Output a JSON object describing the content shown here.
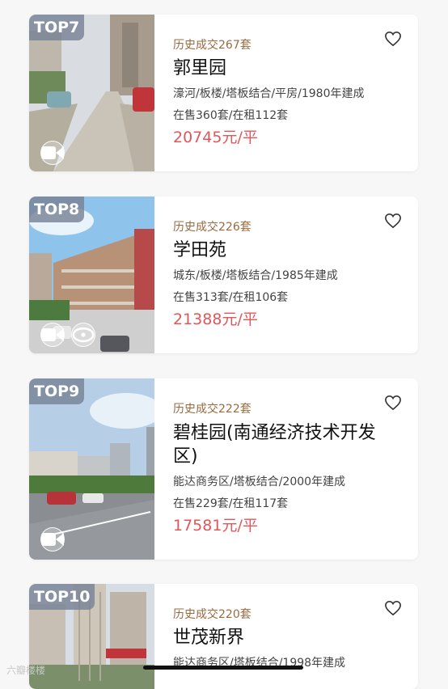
{
  "listings": [
    {
      "rank": "TOP7",
      "deals": "历史成交267套",
      "name": "郭里园",
      "meta": "濠河/板楼/塔板结合/平房/1980年建成",
      "stock": "在售360套/在租112套",
      "price": "20745元/平",
      "colors": {
        "sky": "#d9dde2",
        "ground": "#c9c3b8"
      }
    },
    {
      "rank": "TOP8",
      "deals": "历史成交226套",
      "name": "学田苑",
      "meta": "城东/板楼/塔板结合/1985年建成",
      "stock": "在售313套/在租106套",
      "price": "21388元/平",
      "colors": {
        "sky": "#8ec3ec",
        "ground": "#cfcfcf"
      }
    },
    {
      "rank": "TOP9",
      "deals": "历史成交222套",
      "name": "碧桂园(南通经济技术开发区)",
      "meta": "能达商务区/塔板结合/2000年建成",
      "stock": "在售229套/在租117套",
      "price": "17581元/平",
      "colors": {
        "sky": "#b6cfe6",
        "ground": "#8a8d92"
      }
    },
    {
      "rank": "TOP10",
      "deals": "历史成交220套",
      "name": "世茂新界",
      "meta": "能达商务区/塔板结合/1998年建成",
      "stock": "",
      "price": "",
      "colors": {
        "sky": "#d6dde4",
        "ground": "#a8a8a8"
      }
    }
  ],
  "watermark": "六瓣楼楼",
  "accent": {
    "deal": "#9a6a3f",
    "price": "#e0575a"
  }
}
